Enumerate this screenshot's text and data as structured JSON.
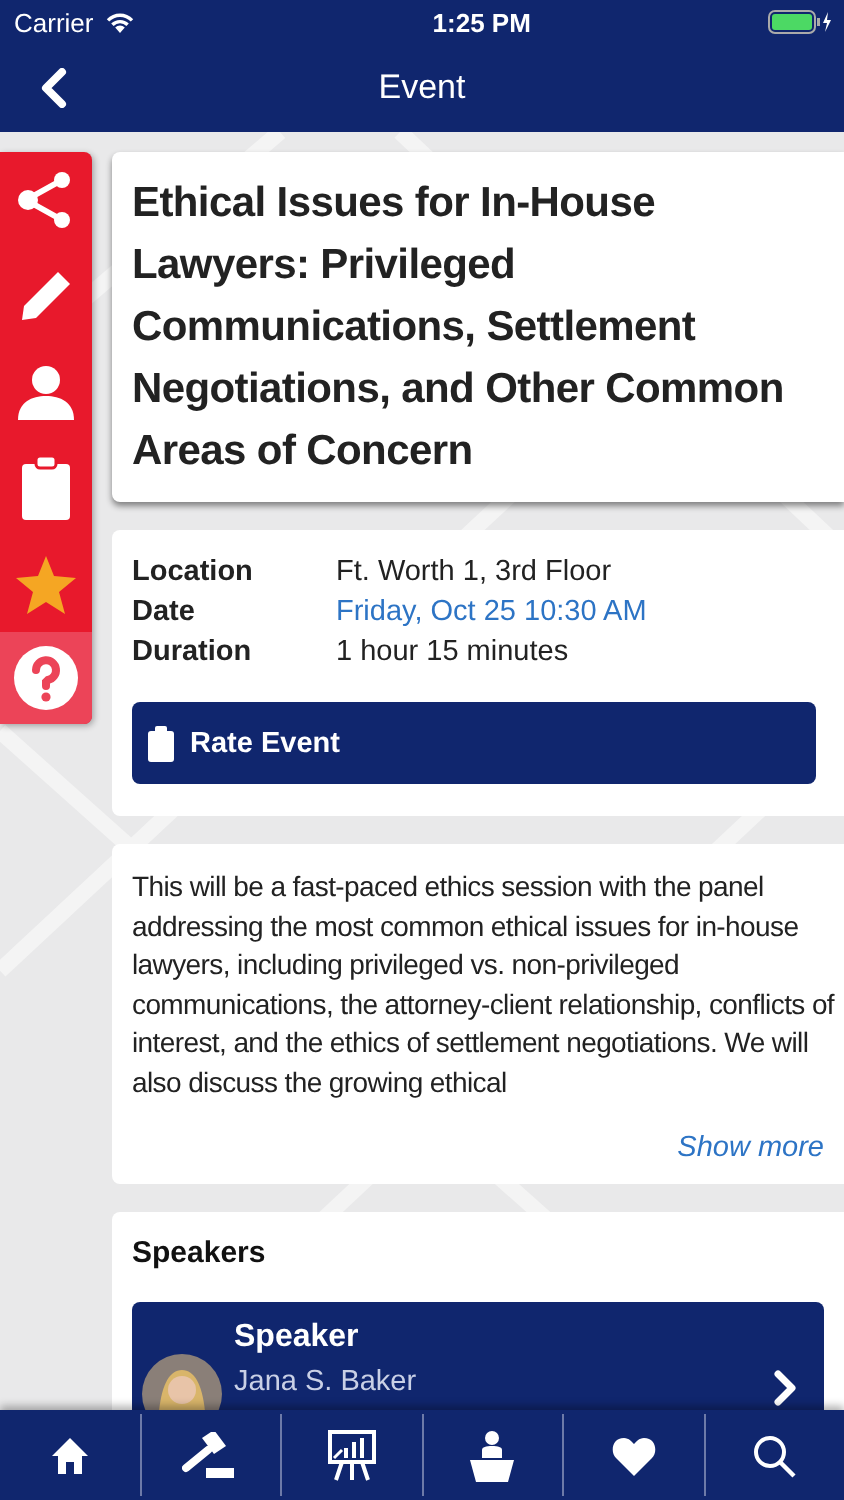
{
  "status_bar": {
    "carrier": "Carrier",
    "time": "1:25 PM",
    "charging": true
  },
  "nav": {
    "title": "Event"
  },
  "side_actions": [
    {
      "kind": "share"
    },
    {
      "kind": "note"
    },
    {
      "kind": "person"
    },
    {
      "kind": "clipboard"
    },
    {
      "kind": "star"
    },
    {
      "kind": "help"
    }
  ],
  "event": {
    "title": "Ethical Issues for In-House Lawyers: Privileged Communications, Settlement Negotiations, and Other Common Areas of Concern",
    "details": [
      {
        "label": "Location",
        "value": "Ft. Worth 1, 3rd Floor",
        "kind": "text"
      },
      {
        "label": "Date",
        "value": "Friday, Oct 25 10:30 AM",
        "kind": "link"
      },
      {
        "label": "Duration",
        "value": "1 hour 15 minutes",
        "kind": "text"
      }
    ],
    "rate_button": "Rate Event",
    "description": "This will be a fast-paced ethics session with the panel addressing the most common ethical issues for in-house lawyers, including privileged vs. non-privileged communications, the attorney-client relationship, conflicts of interest, and the ethics of settlement negotiations.  We will also discuss the growing ethical",
    "show_more": "Show more"
  },
  "speakers": {
    "heading": "Speakers",
    "items": [
      {
        "role": "Speaker",
        "name": "Jana S. Baker"
      }
    ]
  },
  "tab_bar": [
    {
      "kind": "home"
    },
    {
      "kind": "gavel"
    },
    {
      "kind": "presentation"
    },
    {
      "kind": "podium"
    },
    {
      "kind": "heart"
    },
    {
      "kind": "search"
    }
  ]
}
